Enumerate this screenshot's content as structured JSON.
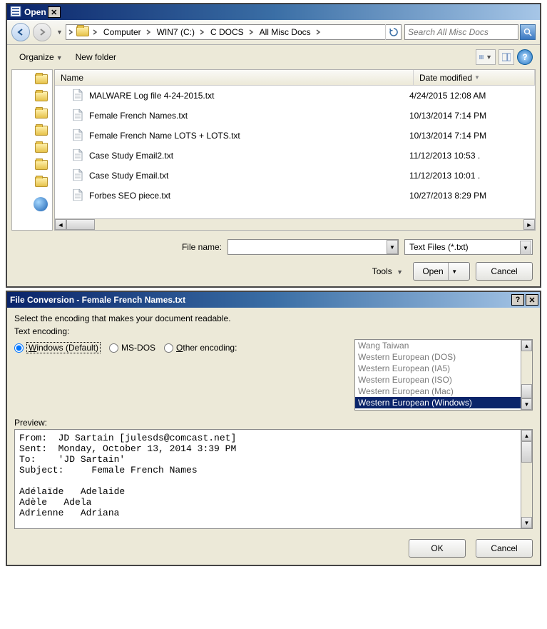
{
  "open": {
    "title": "Open",
    "breadcrumb": [
      "Computer",
      "WIN7 (C:)",
      "C DOCS",
      "All Misc Docs"
    ],
    "search_placeholder": "Search All Misc Docs",
    "organize": "Organize",
    "newfolder": "New folder",
    "columns": {
      "name": "Name",
      "date": "Date modified"
    },
    "rows": [
      {
        "name": "MALWARE Log file 4-24-2015.txt",
        "date": "4/24/2015 12:08 AM"
      },
      {
        "name": "Female French Names.txt",
        "date": "10/13/2014 7:14 PM"
      },
      {
        "name": "Female French Name LOTS + LOTS.txt",
        "date": "10/13/2014 7:14 PM"
      },
      {
        "name": "Case Study Email2.txt",
        "date": "11/12/2013 10:53 ."
      },
      {
        "name": "Case Study Email.txt",
        "date": "11/12/2013 10:01 ."
      },
      {
        "name": "Forbes SEO piece.txt",
        "date": "10/27/2013 8:29 PM"
      }
    ],
    "filename_label": "File name:",
    "filename_value": "",
    "filter": "Text Files (*.txt)",
    "tools": "Tools",
    "open_btn": "Open",
    "cancel_btn": "Cancel"
  },
  "conv": {
    "title": "File Conversion - Female French Names.txt",
    "instruction": "Select the encoding that makes your document readable.",
    "encoding_label": "Text encoding:",
    "radios": {
      "windows": "Windows (Default)",
      "msdos": "MS-DOS",
      "other": "Other encoding:"
    },
    "encodings": [
      "Wang Taiwan",
      "Western European (DOS)",
      "Western European (IA5)",
      "Western European (ISO)",
      "Western European (Mac)",
      "Western European (Windows)"
    ],
    "selected_encoding_index": 5,
    "preview_label": "Preview:",
    "preview_text": "From:  JD Sartain [julesds@comcast.net]\nSent:  Monday, October 13, 2014 3:39 PM\nTo:    'JD Sartain'\nSubject:     Female French Names\n\nAdélaïde   Adelaide\nAdèle   Adela\nAdrienne   Adriana",
    "ok_btn": "OK",
    "cancel_btn": "Cancel"
  }
}
